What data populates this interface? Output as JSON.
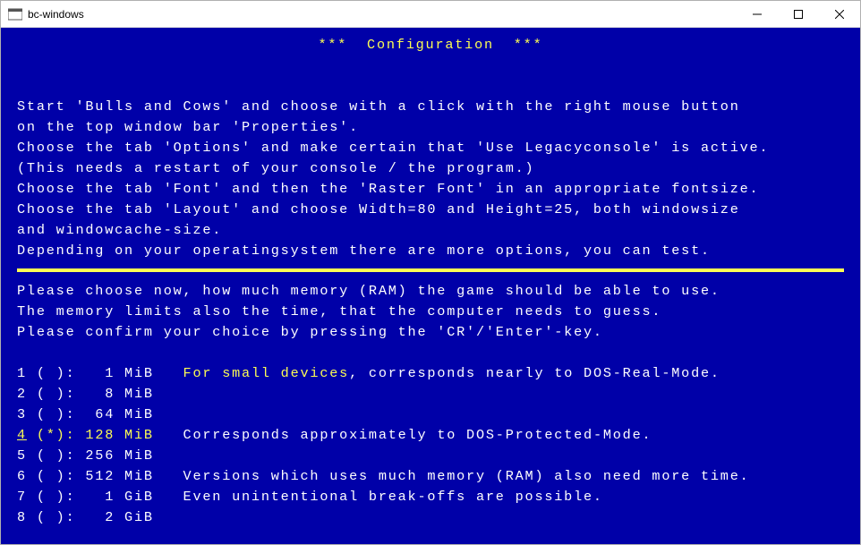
{
  "window": {
    "title": "bc-windows"
  },
  "console": {
    "header_stars_l": "***  ",
    "header_title": "Configuration",
    "header_stars_r": "  ***",
    "para1": [
      "Start 'Bulls and Cows' and choose with a click with the right mouse button",
      "on the top window bar 'Properties'.",
      "Choose the tab 'Options' and make certain that 'Use Legacyconsole' is active.",
      "(This needs a restart of your console / the program.)",
      "Choose the tab 'Font' and then the 'Raster Font' in an appropriate fontsize.",
      "Choose the tab 'Layout' and choose Width=80 and Height=25, both windowsize",
      "and windowcache-size.",
      "Depending on your operatingsystem there are more options, you can test."
    ],
    "para2": [
      "Please choose now, how much memory (RAM) the game should be able to use.",
      "The memory limits also the time, that the computer needs to guess.",
      "Please confirm your choice by pressing the 'CR'/'Enter'-key."
    ],
    "options": [
      {
        "n": "1",
        "mark": " ",
        "size": "  1 MiB",
        "note_hl": "For small devices",
        "note_rest": ", corresponds nearly to DOS-Real-Mode.",
        "highlight": false
      },
      {
        "n": "2",
        "mark": " ",
        "size": "  8 MiB",
        "note_hl": "",
        "note_rest": "",
        "highlight": false
      },
      {
        "n": "3",
        "mark": " ",
        "size": " 64 MiB",
        "note_hl": "",
        "note_rest": "",
        "highlight": false
      },
      {
        "n": "4",
        "mark": "*",
        "size": "128 MiB",
        "note_hl": "",
        "note_rest": "Corresponds approximately to DOS-Protected-Mode.",
        "highlight": true
      },
      {
        "n": "5",
        "mark": " ",
        "size": "256 MiB",
        "note_hl": "",
        "note_rest": "",
        "highlight": false
      },
      {
        "n": "6",
        "mark": " ",
        "size": "512 MiB",
        "note_hl": "",
        "note_rest": "Versions which uses much memory (RAM) also need more time.",
        "highlight": false
      },
      {
        "n": "7",
        "mark": " ",
        "size": "  1 GiB",
        "note_hl": "",
        "note_rest": "Even unintentional break-offs are possible.",
        "highlight": false
      },
      {
        "n": "8",
        "mark": " ",
        "size": "  2 GiB",
        "note_hl": "",
        "note_rest": "",
        "highlight": false
      }
    ]
  }
}
